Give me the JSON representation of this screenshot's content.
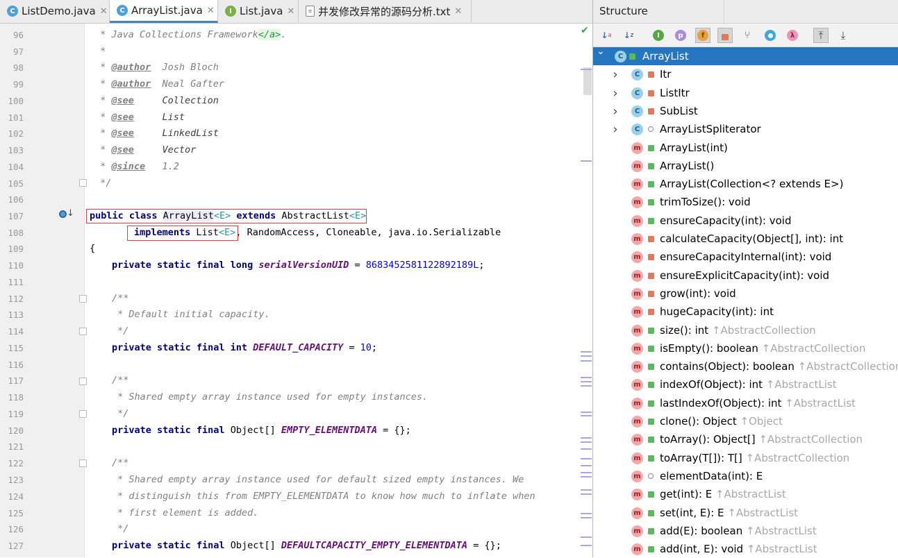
{
  "tabs": [
    {
      "label": "ListDemo.java",
      "icon": "C",
      "color": "#4fa0d8",
      "closable": true
    },
    {
      "label": "ArrayList.java",
      "icon": "C",
      "color": "#4fa0d8",
      "closable": true,
      "active": true
    },
    {
      "label": "List.java",
      "icon": "I",
      "color": "#7cae4a",
      "closable": true
    },
    {
      "label": "并发修改异常的源码分析.txt",
      "icon": "txt",
      "color": "#888888",
      "closable": true
    }
  ],
  "editor": {
    "lines": [
      {
        "n": "96"
      },
      {
        "n": "97"
      },
      {
        "n": "98"
      },
      {
        "n": "99"
      },
      {
        "n": "100"
      },
      {
        "n": "101"
      },
      {
        "n": "102"
      },
      {
        "n": "103"
      },
      {
        "n": "104"
      },
      {
        "n": "105"
      },
      {
        "n": "106"
      },
      {
        "n": "107"
      },
      {
        "n": "108"
      },
      {
        "n": "109"
      },
      {
        "n": "110"
      },
      {
        "n": "111"
      },
      {
        "n": "112"
      },
      {
        "n": "113"
      },
      {
        "n": "114"
      },
      {
        "n": "115"
      },
      {
        "n": "116"
      },
      {
        "n": "117"
      },
      {
        "n": "118"
      },
      {
        "n": "119"
      },
      {
        "n": "120"
      },
      {
        "n": "121"
      },
      {
        "n": "122"
      },
      {
        "n": "123"
      },
      {
        "n": "124"
      },
      {
        "n": "125"
      },
      {
        "n": "126"
      },
      {
        "n": "127"
      }
    ],
    "code": {
      "l96a": " * Java Collections Framework",
      "l96b": "</a>",
      "l96c": ".",
      "l97": " *",
      "l98tag": "@author",
      "l98v": "  Josh Bloch",
      "l99tag": "@author",
      "l99v": "  Neal Gafter",
      "l100tag": "@see",
      "l100v": "     Collection",
      "l101tag": "@see",
      "l101v": "     List",
      "l102tag": "@see",
      "l102v": "     LinkedList",
      "l103tag": "@see",
      "l103v": "     Vector",
      "l104tag": "@since",
      "l104v": "   1.2",
      "star": " * ",
      "l105": " */",
      "l107kw1": "public class ",
      "l107name": "ArrayList",
      "l107t1": "<E>",
      "l107kw2": " extends ",
      "l107sup": "AbstractList",
      "l107t2": "<E>",
      "l108kw": "implements ",
      "l108a": "List",
      "l108t": "<E>",
      "l108b": ", RandomAccess, Cloneable, java.io.Serializable",
      "l109": "{",
      "l110kw": "private static final long ",
      "l110f": "serialVersionUID",
      "l110eq": " = ",
      "l110n": "8683452581122892189L",
      "l110e": ";",
      "l112": "/**",
      "l113": " * Default initial capacity.",
      "l114": " */",
      "l115kw": "private static final int ",
      "l115f": "DEFAULT_CAPACITY",
      "l115eq": " = ",
      "l115n": "10",
      "l115e": ";",
      "l117": "/**",
      "l118": " * Shared empty array instance used for empty instances.",
      "l119": " */",
      "l120kw": "private static final ",
      "l120t": "Object[] ",
      "l120f": "EMPTY_ELEMENTDATA",
      "l120e": " = {};",
      "l122": "/**",
      "l123": " * Shared empty array instance used for default sized empty instances. We",
      "l124": " * distinguish this from EMPTY_ELEMENTDATA to know how much to inflate when",
      "l125": " * first element is added.",
      "l126": " */",
      "l127kw": "private static final ",
      "l127t": "Object[] ",
      "l127f": "DEFAULTCAPACITY_EMPTY_ELEMENTDATA",
      "l127e": " = {};"
    },
    "check_icon": "✔"
  },
  "structure": {
    "title": "Structure",
    "toolbar": [
      {
        "name": "sort-by-type-icon",
        "glyph": "↓a"
      },
      {
        "name": "sort-alpha-icon",
        "glyph": "↓z"
      },
      {
        "name": "show-inherited-icon",
        "glyph": "I",
        "color": "#56a846"
      },
      {
        "name": "show-properties-icon",
        "glyph": "p",
        "color": "#9b6fcf"
      },
      {
        "name": "show-fields-icon",
        "glyph": "f",
        "color": "#e6a23c"
      },
      {
        "name": "show-non-public-icon",
        "glyph": "🔒",
        "color": "#e07a5a"
      },
      {
        "name": "show-anonymous-icon",
        "glyph": "⑂"
      },
      {
        "name": "show-lambdas-icon",
        "glyph": "λ",
        "color": "#e88eb1"
      },
      {
        "name": "circle-icon",
        "glyph": "●",
        "color": "#3ea7db"
      },
      {
        "name": "autoscroll-to-source-icon",
        "glyph": "⤒"
      },
      {
        "name": "autoscroll-from-source-icon",
        "glyph": "⤓"
      }
    ],
    "items": [
      {
        "label": "ArrayList",
        "kind": "C",
        "vis": "pub",
        "expand": "▾",
        "selected": true,
        "level": 0,
        "inh": ""
      },
      {
        "label": "Itr",
        "kind": "C",
        "vis": "prv",
        "expand": "›",
        "level": 1,
        "inh": ""
      },
      {
        "label": "ListItr",
        "kind": "C",
        "vis": "prv",
        "expand": "›",
        "level": 1,
        "inh": ""
      },
      {
        "label": "SubList",
        "kind": "C",
        "vis": "prv",
        "expand": "›",
        "level": 1,
        "inh": ""
      },
      {
        "label": "ArrayListSpliterator",
        "kind": "C",
        "vis": "pkg",
        "expand": "›",
        "level": 1,
        "inh": ""
      },
      {
        "label": "ArrayList(int)",
        "kind": "m",
        "vis": "pub",
        "level": 1,
        "inh": ""
      },
      {
        "label": "ArrayList()",
        "kind": "m",
        "vis": "pub",
        "level": 1,
        "inh": ""
      },
      {
        "label": "ArrayList(Collection<? extends E>)",
        "kind": "m",
        "vis": "pub",
        "level": 1,
        "inh": ""
      },
      {
        "label": "trimToSize(): void",
        "kind": "m",
        "vis": "pub",
        "level": 1,
        "inh": ""
      },
      {
        "label": "ensureCapacity(int): void",
        "kind": "m",
        "vis": "pub",
        "level": 1,
        "inh": ""
      },
      {
        "label": "calculateCapacity(Object[], int): int",
        "kind": "m",
        "vis": "prv",
        "level": 1,
        "inh": ""
      },
      {
        "label": "ensureCapacityInternal(int): void",
        "kind": "m",
        "vis": "prv",
        "level": 1,
        "inh": ""
      },
      {
        "label": "ensureExplicitCapacity(int): void",
        "kind": "m",
        "vis": "prv",
        "level": 1,
        "inh": ""
      },
      {
        "label": "grow(int): void",
        "kind": "m",
        "vis": "prv",
        "level": 1,
        "inh": ""
      },
      {
        "label": "hugeCapacity(int): int",
        "kind": "m",
        "vis": "prv",
        "level": 1,
        "inh": ""
      },
      {
        "label": "size(): int",
        "kind": "m",
        "vis": "pub",
        "level": 1,
        "inh": "↑AbstractCollection"
      },
      {
        "label": "isEmpty(): boolean",
        "kind": "m",
        "vis": "pub",
        "level": 1,
        "inh": "↑AbstractCollection"
      },
      {
        "label": "contains(Object): boolean",
        "kind": "m",
        "vis": "pub",
        "level": 1,
        "inh": "↑AbstractCollection"
      },
      {
        "label": "indexOf(Object): int",
        "kind": "m",
        "vis": "pub",
        "level": 1,
        "inh": "↑AbstractList"
      },
      {
        "label": "lastIndexOf(Object): int",
        "kind": "m",
        "vis": "pub",
        "level": 1,
        "inh": "↑AbstractList"
      },
      {
        "label": "clone(): Object",
        "kind": "m",
        "vis": "pub",
        "level": 1,
        "inh": "↑Object"
      },
      {
        "label": "toArray(): Object[]",
        "kind": "m",
        "vis": "pub",
        "level": 1,
        "inh": "↑AbstractCollection"
      },
      {
        "label": "toArray(T[]): T[]",
        "kind": "m",
        "vis": "pub",
        "level": 1,
        "inh": "↑AbstractCollection"
      },
      {
        "label": "elementData(int): E",
        "kind": "m",
        "vis": "pkg",
        "level": 1,
        "inh": ""
      },
      {
        "label": "get(int): E",
        "kind": "m",
        "vis": "pub",
        "level": 1,
        "inh": "↑AbstractList"
      },
      {
        "label": "set(int, E): E",
        "kind": "m",
        "vis": "pub",
        "level": 1,
        "inh": "↑AbstractList"
      },
      {
        "label": "add(E): boolean",
        "kind": "m",
        "vis": "pub",
        "level": 1,
        "inh": "↑AbstractList"
      },
      {
        "label": "add(int, E): void",
        "kind": "m",
        "vis": "pub",
        "level": 1,
        "inh": "↑AbstractList"
      }
    ]
  }
}
